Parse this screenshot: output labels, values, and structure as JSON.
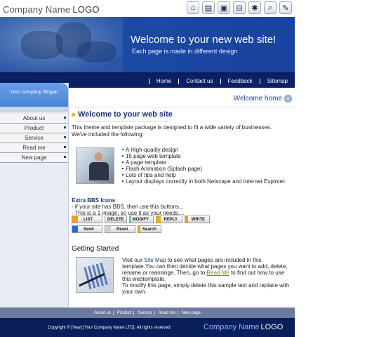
{
  "header": {
    "company_name": "Company Name",
    "logo_word": "LOGO",
    "icons": [
      "home-icon",
      "folder-icon",
      "document-icon",
      "cart-icon",
      "tools-icon",
      "search-icon",
      "edit-icon"
    ]
  },
  "banner": {
    "title": "Welcome to your new web site!",
    "subtitle": "Each page is made in different design"
  },
  "nav": {
    "items": [
      "Home",
      "Contact us",
      "Feedback",
      "Sitemap"
    ]
  },
  "sidebar": {
    "slogan": "Your company Slogan",
    "items": [
      "About us",
      "Product",
      "Service",
      "Read me",
      "New page"
    ]
  },
  "main": {
    "welcome_home": "Welcome home",
    "heading": "Welcome to your web site",
    "intro": "This theme and template package is designed to fit a wide variety of businesses. We've included the following:",
    "features": [
      "A High-quality design",
      "15 page web template",
      "A page template",
      "Flash Animation (Splash page)",
      "Lots of tips and help",
      "Layout displays correctly in both Netscape and Internet Explorer."
    ],
    "bbs": {
      "title": "Extra BBS Icons",
      "line1": "- if your site has BBS, then use this buttons...",
      "line2": "- This is a 1 image, so use it as your needs....",
      "row1": [
        {
          "label": "LIST",
          "color": "#f0a020"
        },
        {
          "label": "DELETE",
          "color": "#4caf50"
        },
        {
          "label": "MODIFY",
          "color": "#2aa0a8"
        },
        {
          "label": "REPLY",
          "color": "#e8b400"
        },
        {
          "label": "WRITE",
          "color": "#f0a020"
        }
      ],
      "row2": [
        {
          "label": "Send",
          "color": "#1e6fd0"
        },
        {
          "label": "Reset",
          "color": "#cfcfcf"
        },
        {
          "label": "Search",
          "color": "#f0a020"
        }
      ]
    },
    "getting_started": {
      "heading": "Getting Started",
      "t1": "Visit our ",
      "link_sitemap": "Site Map",
      "t2": " to see what pages are included in this template.You can then decide what pages you want to add, delete, rename,or rearrange. Then, go to ",
      "link_readme": "Read Me",
      "t3": " to find out how to use this webtemplate.",
      "t4": "To modify this page, simply delete this sample text and replace with  your own."
    }
  },
  "footer": {
    "links": [
      "About us",
      "Product",
      "Service",
      "Read me",
      "New page"
    ],
    "copyright": "Copyright © [Year] [Your Company Name LTD]. All rights reserved",
    "company_name": "Company Name",
    "logo_word": "LOGO"
  }
}
